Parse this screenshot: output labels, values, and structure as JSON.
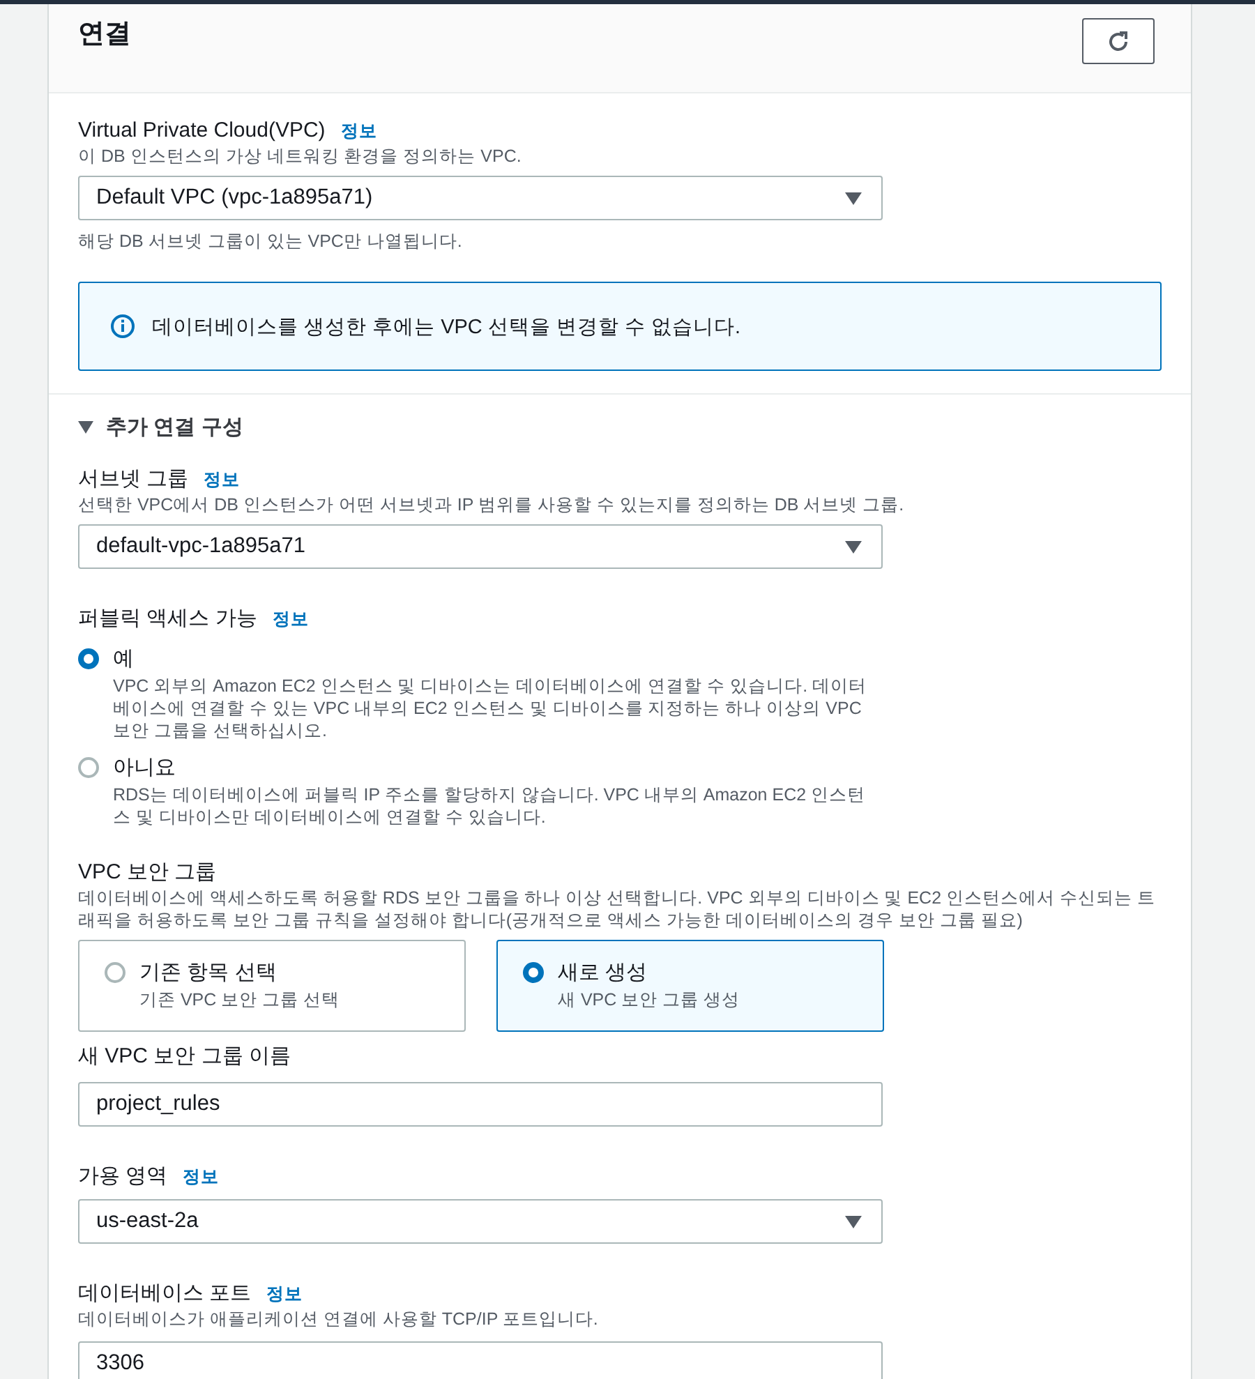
{
  "section": {
    "title": "연결"
  },
  "vpc": {
    "label": "Virtual Private Cloud(VPC)",
    "info": "정보",
    "description": "이 DB 인스턴스의 가상 네트워킹 환경을 정의하는 VPC.",
    "value": "Default VPC (vpc-1a895a71)",
    "hint": "해당 DB 서브넷 그룹이 있는 VPC만 나열됩니다."
  },
  "alert": {
    "text": "데이터베이스를 생성한 후에는 VPC 선택을 변경할 수 없습니다."
  },
  "additional": {
    "title": "추가 연결 구성",
    "expanded": true
  },
  "subnet_group": {
    "label": "서브넷 그룹",
    "info": "정보",
    "description": "선택한 VPC에서 DB 인스턴스가 어떤 서브넷과 IP 범위를 사용할 수 있는지를 정의하는 DB 서브넷 그룹.",
    "value": "default-vpc-1a895a71"
  },
  "public_access": {
    "label": "퍼블릭 액세스 가능",
    "info": "정보",
    "options": [
      {
        "label": "예",
        "description": "VPC 외부의 Amazon EC2 인스턴스 및 디바이스는 데이터베이스에 연결할 수 있습니다. 데이터베이스에 연결할 수 있는 VPC 내부의 EC2 인스턴스 및 디바이스를 지정하는 하나 이상의 VPC 보안 그룹을 선택하십시오.",
        "selected": true
      },
      {
        "label": "아니요",
        "description": "RDS는 데이터베이스에 퍼블릭 IP 주소를 할당하지 않습니다. VPC 내부의 Amazon EC2 인스턴스 및 디바이스만 데이터베이스에 연결할 수 있습니다.",
        "selected": false
      }
    ]
  },
  "security_group": {
    "label": "VPC 보안 그룹",
    "description": "데이터베이스에 액세스하도록 허용할 RDS 보안 그룹을 하나 이상 선택합니다. VPC 외부의 디바이스 및 EC2 인스턴스에서 수신되는 트래픽을 허용하도록 보안 그룹 규칙을 설정해야 합니다(공개적으로 액세스 가능한 데이터베이스의 경우 보안 그룹 필요)",
    "options": [
      {
        "label": "기존 항목 선택",
        "description": "기존 VPC 보안 그룹 선택",
        "selected": false
      },
      {
        "label": "새로 생성",
        "description": "새 VPC 보안 그룹 생성",
        "selected": true
      }
    ]
  },
  "new_group_name": {
    "label": "새 VPC 보안 그룹 이름",
    "value": "project_rules"
  },
  "availability_zone": {
    "label": "가용 영역",
    "info": "정보",
    "value": "us-east-2a"
  },
  "port": {
    "label": "데이터베이스 포트",
    "info": "정보",
    "description": "데이터베이스가 애플리케이션 연결에 사용할 TCP/IP 포트입니다.",
    "value": "3306"
  }
}
